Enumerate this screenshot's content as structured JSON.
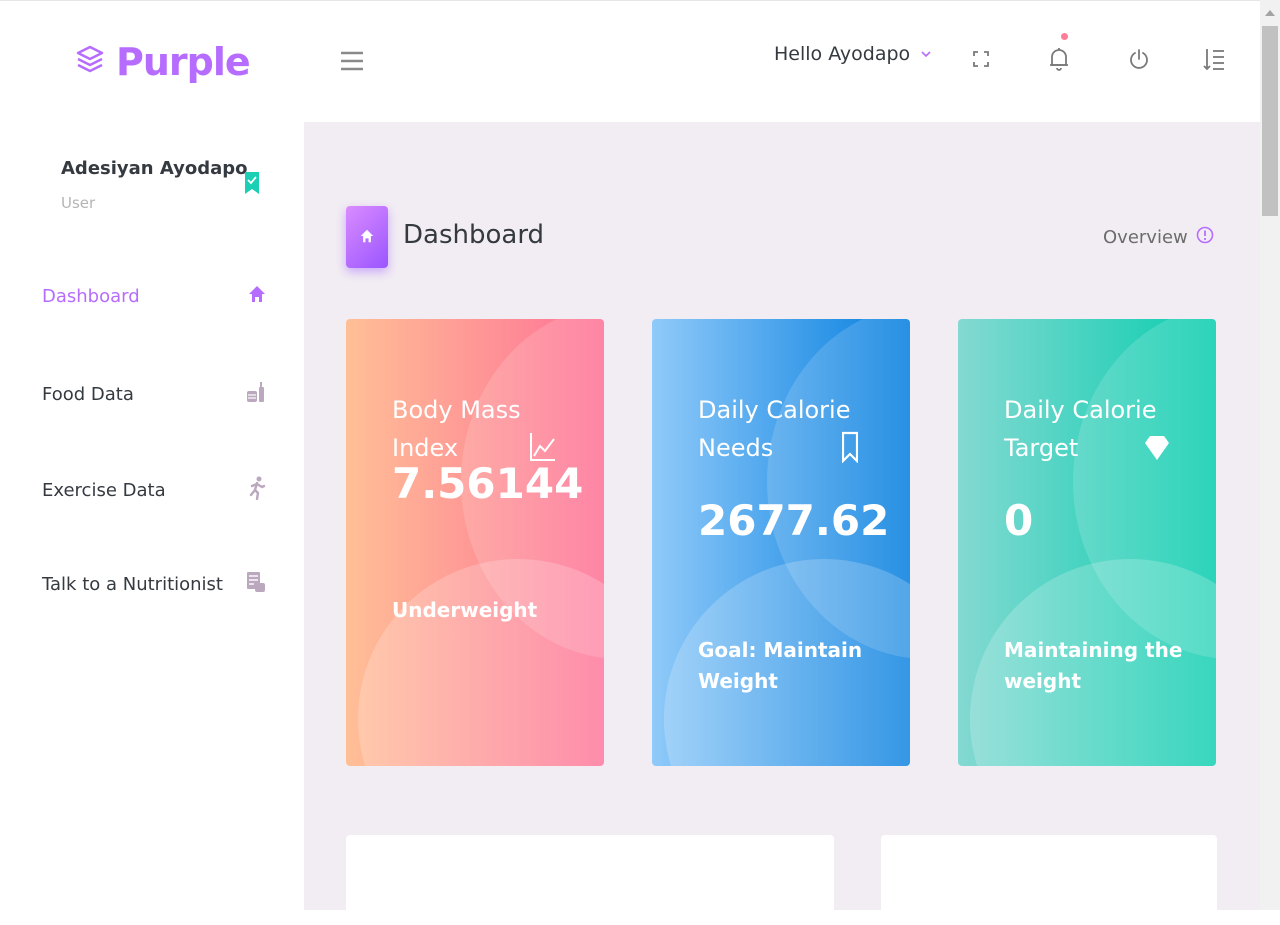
{
  "brand": {
    "name": "Purple",
    "color": "#b66dff",
    "icon": "layers-icon"
  },
  "header": {
    "greeting": "Hello Ayodapo",
    "icons": [
      "menu-icon",
      "fullscreen-icon",
      "bell-icon",
      "power-icon",
      "settings-list-icon"
    ]
  },
  "profile": {
    "name": "Adesiyan Ayodapo",
    "role": "User"
  },
  "sidebar": {
    "items": [
      {
        "label": "Dashboard",
        "icon": "home-icon",
        "active": true
      },
      {
        "label": "Food Data",
        "icon": "food-icon"
      },
      {
        "label": "Exercise Data",
        "icon": "run-icon"
      },
      {
        "label": "Talk to a Nutritionist",
        "icon": "chat-list-icon"
      }
    ]
  },
  "page": {
    "title": "Dashboard",
    "overview": "Overview"
  },
  "cards": [
    {
      "title": "Body Mass Index",
      "value": "7.56144",
      "subtitle": "Underweight",
      "icon": "chart-line-icon",
      "color_from": "#ffbf96",
      "color_to": "#fe7096"
    },
    {
      "title": "Daily Calorie Needs",
      "value": "2677.62",
      "subtitle": "Goal: Maintain Weight",
      "icon": "bookmark-icon",
      "color_from": "#90caf9",
      "color_to": "#047edf"
    },
    {
      "title": "Daily Calorie Target",
      "value": "0",
      "subtitle": "Maintaining the weight",
      "icon": "diamond-icon",
      "color_from": "#84d9d2",
      "color_to": "#07cdae"
    }
  ],
  "colors": {
    "content_bg": "#f2edf3",
    "accent": "#b66dff",
    "notification_dot": "#fe7c96"
  }
}
